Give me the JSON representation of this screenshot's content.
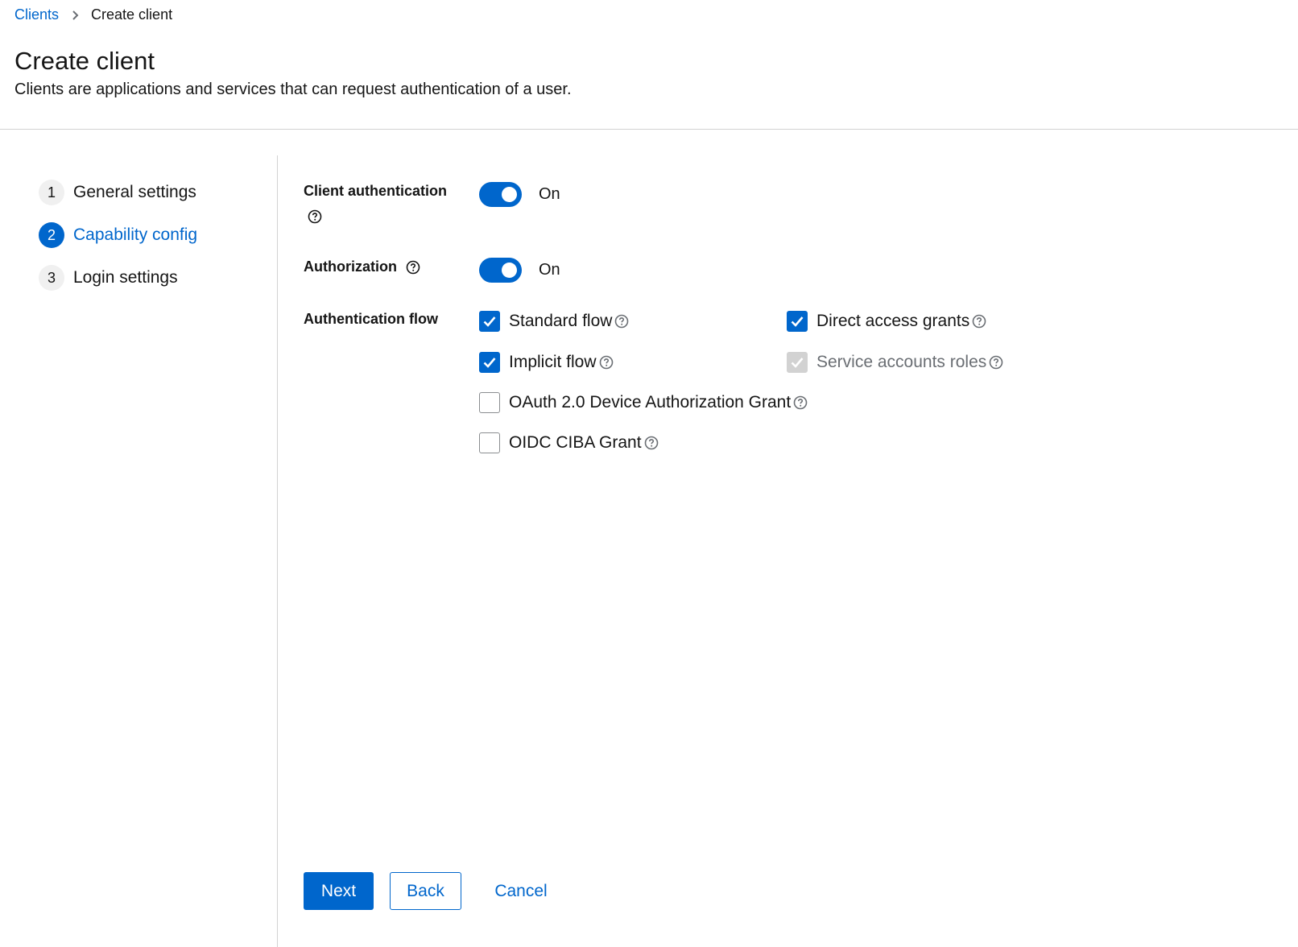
{
  "breadcrumb": {
    "parent": "Clients",
    "current": "Create client"
  },
  "header": {
    "title": "Create client",
    "description": "Clients are applications and services that can request authentication of a user."
  },
  "wizard": {
    "steps": [
      {
        "number": "1",
        "label": "General settings",
        "active": false
      },
      {
        "number": "2",
        "label": "Capability config",
        "active": true
      },
      {
        "number": "3",
        "label": "Login settings",
        "active": false
      }
    ]
  },
  "form": {
    "client_authentication": {
      "label": "Client authentication",
      "state": "On"
    },
    "authorization": {
      "label": "Authorization",
      "state": "On"
    },
    "authentication_flow": {
      "label": "Authentication flow",
      "options": [
        {
          "label": "Standard flow",
          "checked": true,
          "disabled": false
        },
        {
          "label": "Direct access grants",
          "checked": true,
          "disabled": false
        },
        {
          "label": "Implicit flow",
          "checked": true,
          "disabled": false
        },
        {
          "label": "Service accounts roles",
          "checked": true,
          "disabled": true
        },
        {
          "label": "OAuth 2.0 Device Authorization Grant",
          "checked": false,
          "disabled": false
        },
        {
          "label": "OIDC CIBA Grant",
          "checked": false,
          "disabled": false
        }
      ]
    }
  },
  "actions": {
    "next": "Next",
    "back": "Back",
    "cancel": "Cancel"
  },
  "colors": {
    "primary": "#0066cc",
    "border": "#d2d2d2",
    "text": "#151515"
  }
}
